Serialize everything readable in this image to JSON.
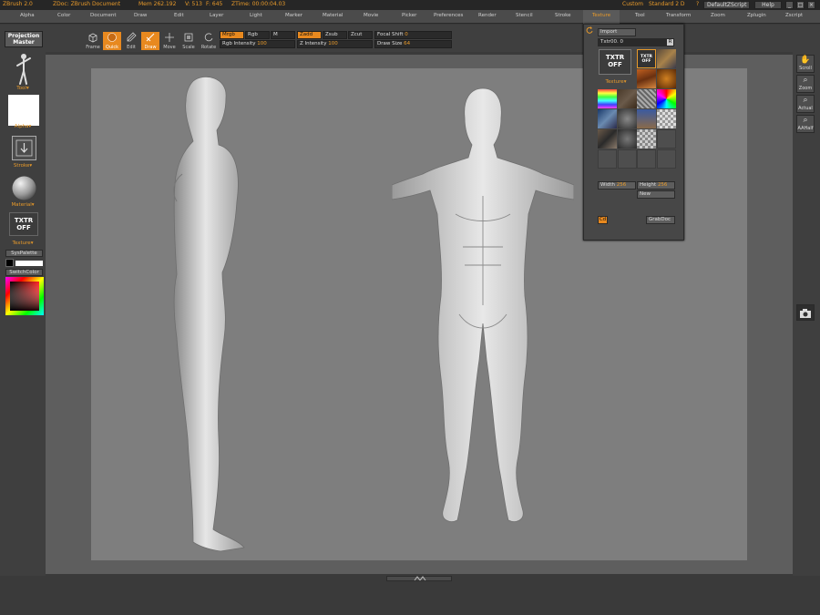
{
  "titlebar": {
    "app": "ZBrush 2.0",
    "doc": "ZDoc: ZBrush Document",
    "mem": "Mem 262.192",
    "v": "V: 513",
    "fs": "F: 645",
    "ztime": "ZTime: 00:00:04.03",
    "custom": "Custom",
    "standard": "Standard 2 D",
    "question": "?",
    "zscript": "DefaultZScript",
    "help": "Help",
    "win_min": "_",
    "win_max": "□",
    "win_close": "×"
  },
  "menu": [
    "Alpha",
    "Color",
    "Document",
    "Draw",
    "Edit",
    "Layer",
    "Light",
    "Marker",
    "Material",
    "Movie",
    "Picker",
    "Preferences",
    "Render",
    "Stencil",
    "Stroke",
    "Texture",
    "Tool",
    "Transform",
    "Zoom",
    "Zplugin",
    "Zscript"
  ],
  "toolbar": {
    "projection_master": "Projection Master",
    "tools": [
      "Frame",
      "Quick",
      "Edit",
      "Draw",
      "Move",
      "Scale",
      "Rotate"
    ],
    "mrgb": "Mrgb",
    "rgb": "Rgb",
    "m": "M",
    "rgb_intensity_label": "Rgb Intensity",
    "rgb_intensity_value": "100",
    "zadd": "Zadd",
    "zsub": "Zsub",
    "zcut": "Zcut",
    "z_intensity_label": "Z Intensity",
    "z_intensity_value": "100",
    "focal_shift_label": "Focal Shift",
    "focal_shift_value": "0",
    "draw_size_label": "Draw Size",
    "draw_size_value": "64"
  },
  "leftshelf": {
    "tool_label": "Tool",
    "alpha_label": "Alpha",
    "stroke_label": "Stroke",
    "material_label": "Material",
    "texture_btn": "TXTR OFF",
    "texture_label": "Texture",
    "syspalette": "SysPalette",
    "switchcolor": "SwitchColor"
  },
  "rightshelf": {
    "scroll": "Scroll",
    "zoom": "Zoom",
    "actual": "Actual",
    "aahalf": "AAHalf"
  },
  "texture_palette": {
    "import": "Import",
    "name_field": "Txtr00. 0",
    "r_button": "R",
    "big_preview": "TXTR OFF",
    "small_preview": "TXTR OFF",
    "texture_label": "Texture",
    "width_label": "Width",
    "width_value": "256",
    "height_label": "Height",
    "height_value": "256",
    "new": "New",
    "cd": "Cd",
    "grabdoc": "GrabDoc"
  },
  "colors": {
    "accent": "#e8891f",
    "accent_text": "#e89a2a",
    "canvas_doc": "#7e7e7e"
  }
}
